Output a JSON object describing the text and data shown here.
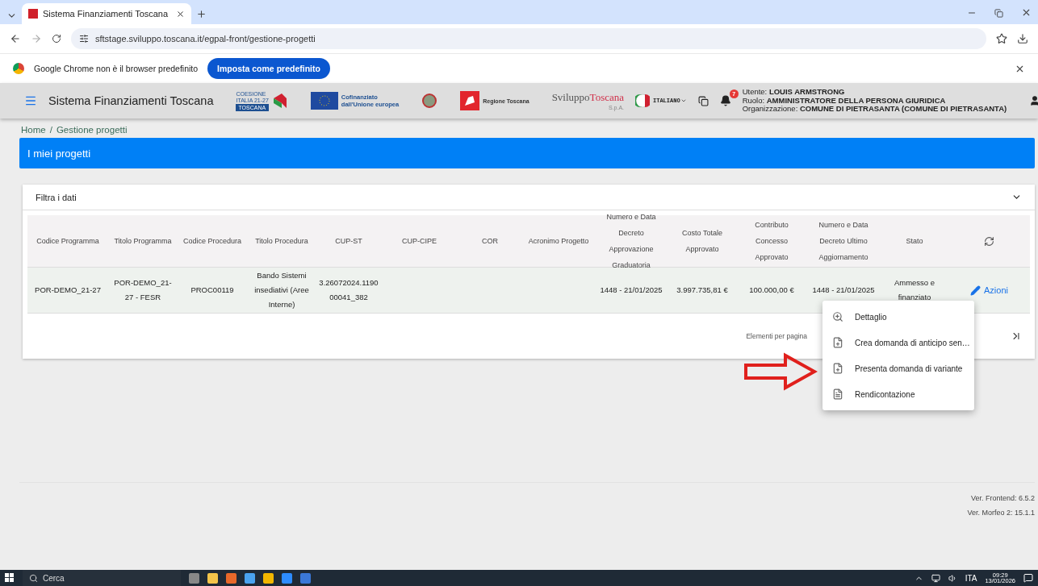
{
  "browser": {
    "tab_title": "Sistema Finanziamenti Toscana",
    "url": "sftstage.sviluppo.toscana.it/egpal-front/gestione-progetti",
    "infobar_text": "Google Chrome non è il browser predefinito",
    "infobar_button": "Imposta come predefinito"
  },
  "header": {
    "app_title": "Sistema Finanziamenti Toscana",
    "coesione_lines": [
      "COESIONE",
      "ITALIA 21-27"
    ],
    "coesione_region": "TOSCANA",
    "eu_text": [
      "Cofinanziato",
      "dall'Unione europea"
    ],
    "regione": "Regione Toscana",
    "sviluppo_a": "Sviluppo",
    "sviluppo_b": "Toscana",
    "sviluppo_c": "S.p.A.",
    "language": "ITALIANO",
    "notifications": "7",
    "user": [
      {
        "label": "Utente:",
        "value": "LOUIS ARMSTRONG"
      },
      {
        "label": "Ruolo:",
        "value": "AMMINISTRATORE DELLA PERSONA GIURIDICA"
      },
      {
        "label": "Organizzazione:",
        "value": "COMUNE DI PIETRASANTA (COMUNE DI PIETRASANTA)"
      }
    ]
  },
  "breadcrumb": [
    "Home",
    "Gestione progetti"
  ],
  "breadcrumb_separator": "/",
  "page_title": "I miei progetti",
  "filter": {
    "label": "Filtra i dati",
    "expanded": false
  },
  "table": {
    "columns": [
      "Codice Programma",
      "Titolo Programma",
      "Codice Procedura",
      "Titolo Procedura",
      "CUP-ST",
      "CUP-CIPE",
      "COR",
      "Acronimo Progetto",
      "Numero e Data Decreto Approvazione Graduatoria",
      "Costo Totale Approvato",
      "Contributo Concesso Approvato",
      "Numero e Data Decreto Ultimo Aggiornamento",
      "Stato"
    ],
    "rows": [
      {
        "cells": [
          "POR-DEMO_21-27",
          "POR-DEMO_21-27 - FESR",
          "PROC00119",
          "Bando Sistemi insediativi (Aree Interne)",
          "3.26072024.119000041_382",
          "",
          "",
          "",
          "1448 - 21/01/2025",
          "3.997.735,81 €",
          "100.000,00 €",
          "1448 - 21/01/2025",
          "Ammesso e finanziato"
        ],
        "action": "Azioni"
      }
    ]
  },
  "pagination": {
    "label": "Elementi per pagina"
  },
  "menu": [
    {
      "label": "Dettaglio",
      "kind": "zoom"
    },
    {
      "label": "Crea domanda di anticipo sen…",
      "kind": "doc-plus"
    },
    {
      "label": "Presenta domanda di variante",
      "kind": "doc-plus"
    },
    {
      "label": "Rendicontazione",
      "kind": "doc-dollar"
    }
  ],
  "versions": [
    "Ver. Frontend: 6.5.2",
    "Ver. Morfeo 2: 15.1.1"
  ],
  "taskbar": {
    "search": "Cerca",
    "lang": "ITA",
    "time": "09:29",
    "date": "13/01/2026"
  }
}
